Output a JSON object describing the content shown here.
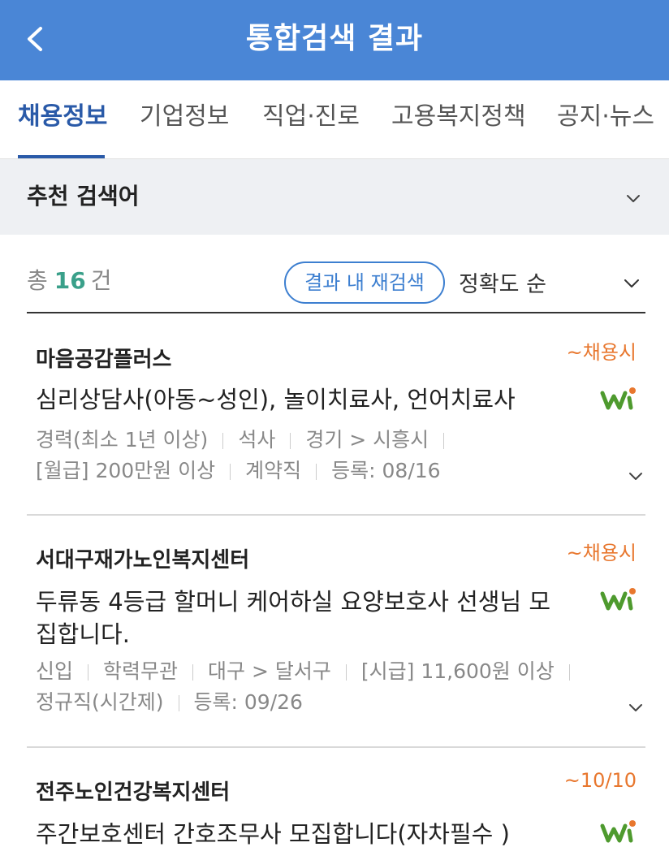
{
  "header": {
    "title": "통합검색 결과",
    "back_icon": "chevron-left-icon"
  },
  "tabs": [
    {
      "label": "채용정보",
      "active": true
    },
    {
      "label": "기업정보",
      "active": false
    },
    {
      "label": "직업·진로",
      "active": false
    },
    {
      "label": "고용복지정책",
      "active": false
    },
    {
      "label": "공지·뉴스",
      "active": false
    }
  ],
  "recommend": {
    "title": "추천 검색어",
    "icon": "chevron-down-icon"
  },
  "summary": {
    "total_prefix": "총",
    "total_count": "16",
    "total_suffix": "건",
    "research_label": "결과 내 재검색",
    "sort_label": "정확도 순"
  },
  "colors": {
    "header": "#4a86d6",
    "active_tab": "#2a5aa8",
    "count": "#3aa08a",
    "deadline": "#e8772e",
    "button": "#3d7fd0"
  },
  "jobs": [
    {
      "company": "마음공감플러스",
      "deadline": "~채용시",
      "title": "심리상담사(아동~성인), 놀이치료사, 언어치료사",
      "meta": [
        "경력(최소 1년 이상)",
        "석사",
        "경기 > 시흥시",
        "[월급] 200만원 이상",
        "계약직",
        "등록: 08/16"
      ]
    },
    {
      "company": "서대구재가노인복지센터",
      "deadline": "~채용시",
      "title": "두류동 4등급 할머니 케어하실 요양보호사 선생님 모집합니다.",
      "meta": [
        "신입",
        "학력무관",
        "대구 > 달서구",
        "[시급] 11,600원 이상",
        "정규직(시간제)",
        "등록: 09/26"
      ]
    },
    {
      "company": "전주노인건강복지센터",
      "deadline": "~10/10",
      "title": "주간보호센터 간호조무사 모집합니다(자차필수 )",
      "meta": []
    }
  ]
}
